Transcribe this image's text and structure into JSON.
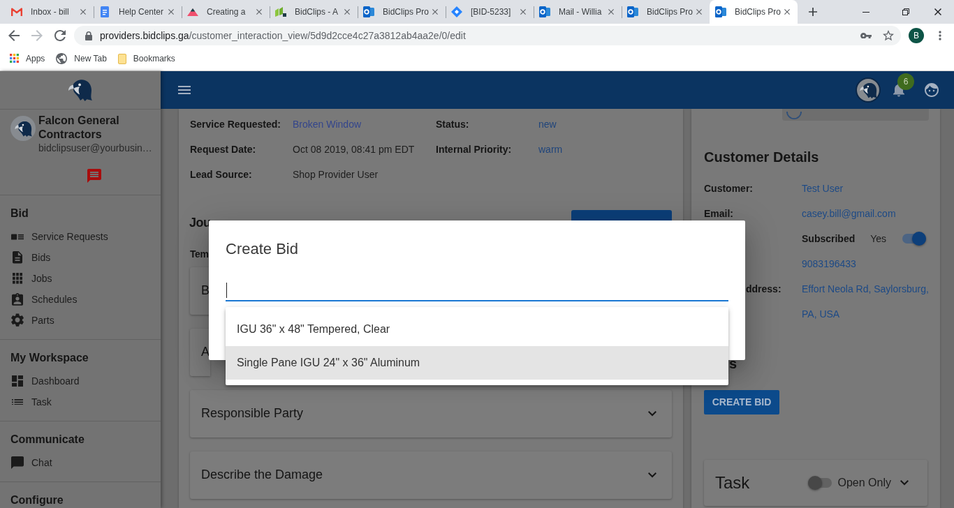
{
  "browser": {
    "tabs": [
      {
        "title": "Inbox - bill",
        "kind": "mail",
        "selected": false
      },
      {
        "title": "Help Center",
        "kind": "doc",
        "selected": false
      },
      {
        "title": "Creating a",
        "kind": "peak",
        "selected": false
      },
      {
        "title": "BidClips - A",
        "kind": "blocks",
        "selected": false
      },
      {
        "title": "BidClips Pro",
        "kind": "obadge",
        "selected": false
      },
      {
        "title": "[BID-5233]",
        "kind": "diamond",
        "selected": false
      },
      {
        "title": "Mail - Willia",
        "kind": "obadge",
        "selected": false
      },
      {
        "title": "BidClips Pro",
        "kind": "obadge",
        "selected": false
      },
      {
        "title": "BidClips Pro",
        "kind": "obadge",
        "selected": true
      }
    ],
    "url": {
      "host": "providers.bidclips.ga",
      "path": "/customer_interaction_view/5d9d2cce4c27a3812ab4aa2e/0/edit"
    },
    "profile_initial": "B",
    "bookmarks": [
      {
        "label": "Apps",
        "kind": "apps"
      },
      {
        "label": "New Tab",
        "kind": "globe"
      },
      {
        "label": "Bookmarks",
        "kind": "folder"
      }
    ]
  },
  "sidebar": {
    "company": "Falcon General Contractors",
    "email": "bidclipsuser@yourbusin…",
    "sections": [
      {
        "title": "Bid",
        "items": [
          {
            "label": "Service Requests",
            "kind": "cards"
          },
          {
            "label": "Bids",
            "kind": "document"
          },
          {
            "label": "Jobs",
            "kind": "grid"
          },
          {
            "label": "Schedules",
            "kind": "badge"
          },
          {
            "label": "Parts",
            "kind": "gear"
          }
        ]
      },
      {
        "title": "My Workspace",
        "items": [
          {
            "label": "Dashboard",
            "kind": "dashboard"
          },
          {
            "label": "Task",
            "kind": "list"
          }
        ]
      },
      {
        "title": "Communicate",
        "items": [
          {
            "label": "Chat",
            "kind": "chat"
          }
        ]
      },
      {
        "title": "Configure"
      }
    ]
  },
  "header": {
    "notification_count": "6"
  },
  "request_details": [
    {
      "label": "Service Requested:",
      "value": "Broken Window",
      "kind": "link"
    },
    {
      "label": "Status:",
      "value": "new",
      "kind": "status"
    },
    {
      "label": "Request Date:",
      "value": "Oct 08 2019, 08:41 pm EDT",
      "kind": "text"
    },
    {
      "label": "Internal Priority:",
      "value": "warm",
      "kind": "status"
    },
    {
      "label": "Lead Source:",
      "value": "Shop Provider User",
      "kind": "text"
    }
  ],
  "journey": {
    "heading": "Jou",
    "template_label": "Tem",
    "panels": [
      {
        "title": "B",
        "covered": true
      },
      {
        "title": "A",
        "covered": true
      },
      {
        "title": "Responsible Party",
        "expanded": false
      },
      {
        "title": "Describe the Damage",
        "expanded": false
      }
    ]
  },
  "customer": {
    "heading": "Customer Details",
    "rows": [
      {
        "kind": "field",
        "label": "Customer:",
        "value": "Test User"
      },
      {
        "kind": "field",
        "label": "Email:",
        "value": "casey.bill@gmail.com"
      },
      {
        "kind": "toggle",
        "label": "Subscribed",
        "value": "Yes",
        "on": true
      },
      {
        "kind": "field",
        "value": "9083196433"
      },
      {
        "kind": "field",
        "label": "ddress:",
        "value": "Effort Neola Rd, Saylorsburg,",
        "covered": true
      },
      {
        "kind": "field",
        "value": "PA, USA"
      }
    ],
    "next_heading": "s",
    "create_button": "CREATE BID"
  },
  "task": {
    "title": "Task",
    "filter_label": "Open Only",
    "on": false,
    "expanded": false
  },
  "modal": {
    "title": "Create Bid",
    "options": [
      {
        "label": "IGU 36\" x 48\" Tempered, Clear",
        "selected": false
      },
      {
        "label": "Single Pane IGU 24\" x 36\" Aluminum",
        "selected": true
      }
    ]
  }
}
